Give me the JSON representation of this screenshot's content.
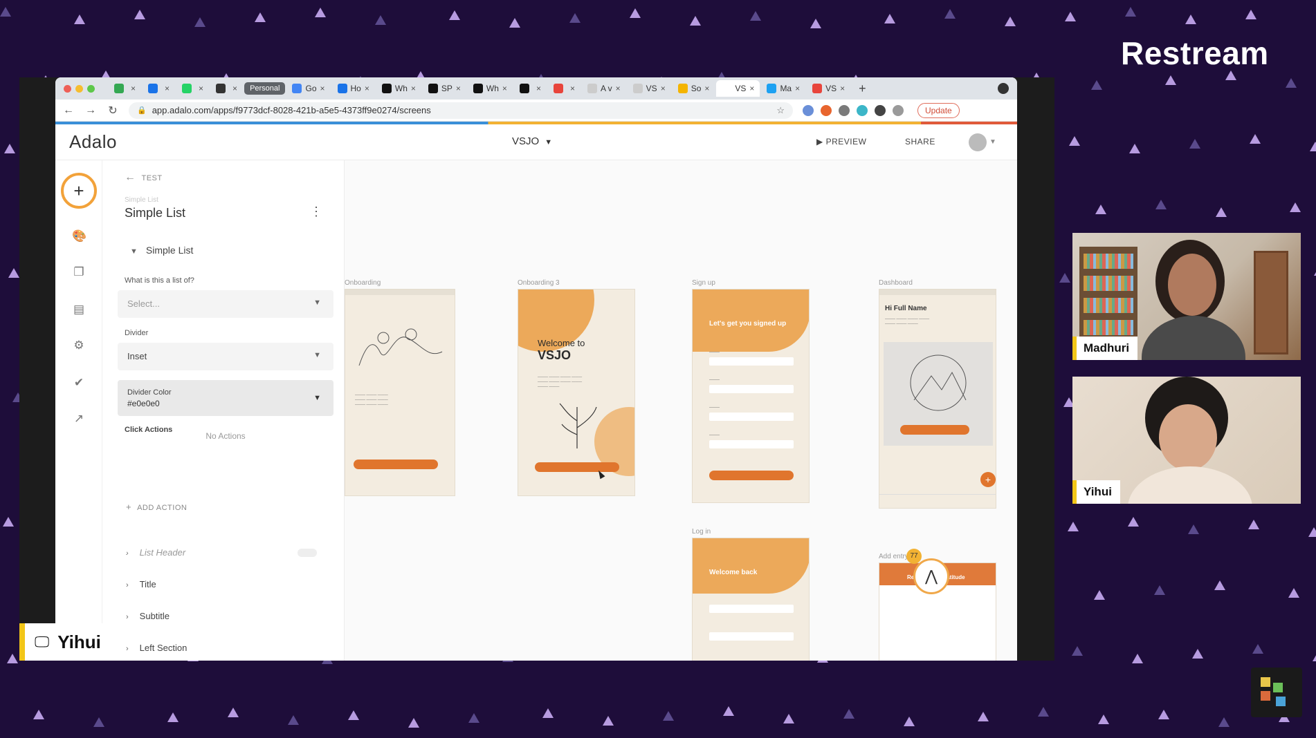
{
  "brand": "Restream",
  "browser": {
    "tabs": [
      {
        "label": "",
        "fav": "#34a853",
        "icon": "sheets-icon"
      },
      {
        "label": "",
        "fav": "#1a73e8",
        "icon": "telegram-icon"
      },
      {
        "label": "",
        "fav": "#25d366",
        "icon": "whatsapp-icon"
      },
      {
        "label": "",
        "fav": "#333333",
        "icon": "laptop-icon"
      },
      {
        "label": "Personal",
        "personal": true
      },
      {
        "label": "Go",
        "fav": "#4285f4",
        "icon": "docs-icon"
      },
      {
        "label": "Ho",
        "fav": "#1a73e8",
        "icon": "q-icon"
      },
      {
        "label": "Wh",
        "fav": "#111111",
        "icon": "cm-icon"
      },
      {
        "label": "SP",
        "fav": "#111111",
        "icon": "cm-icon"
      },
      {
        "label": "Wh",
        "fav": "#111111",
        "icon": "box-icon"
      },
      {
        "label": "",
        "fav": "#111111",
        "icon": "r-icon"
      },
      {
        "label": "",
        "fav": "#e8453c",
        "icon": "record-icon"
      },
      {
        "label": "A v",
        "fav": "#cccccc",
        "icon": "doc-icon"
      },
      {
        "label": "VS",
        "fav": "#cccccc",
        "icon": "doc-icon"
      },
      {
        "label": "So",
        "fav": "#f4b400",
        "icon": "slides-icon"
      },
      {
        "label": "VS",
        "fav": "#ffffff",
        "icon": "adalo-icon",
        "active": true
      },
      {
        "label": "Ma",
        "fav": "#1da1f2",
        "icon": "twitter-icon"
      },
      {
        "label": "VS",
        "fav": "#e8453c",
        "icon": "figma-icon"
      }
    ],
    "url": "app.adalo.com/apps/f9773dcf-8028-421b-a5e5-4373ff9e0274/screens",
    "update_label": "Update"
  },
  "appbar": {
    "logo": "Adalo",
    "app_name": "VSJO",
    "preview_label": "PREVIEW",
    "share_label": "SHARE"
  },
  "panel": {
    "back_label": "TEST",
    "component_subtitle": "Simple List",
    "component_title": "Simple List",
    "section_title": "Simple List",
    "list_of_label": "What is this a list of?",
    "list_of_placeholder": "Select...",
    "divider_label": "Divider",
    "divider_value": "Inset",
    "divider_color_label": "Divider Color",
    "divider_color_value": "#e0e0e0",
    "click_actions_label": "Click Actions",
    "no_actions": "No Actions",
    "add_action": "ADD ACTION",
    "rows": [
      "List Header",
      "Title",
      "Subtitle",
      "Left Section"
    ]
  },
  "canvas": {
    "screens": [
      {
        "label": "Onboarding"
      },
      {
        "label": "Onboarding 3",
        "title1": "Welcome to",
        "title2": "VSJO"
      },
      {
        "label": "Sign up",
        "title": "Let's get you signed up"
      },
      {
        "label": "Dashboard",
        "title": "Hi Full Name"
      },
      {
        "label": "Log in",
        "title": "Welcome back"
      },
      {
        "label": "Add entry",
        "title": "Record your gratitude"
      }
    ]
  },
  "fab_badge": "77",
  "presenter": {
    "name": "Yihui"
  },
  "cams": [
    {
      "name": "Madhuri"
    },
    {
      "name": "Yihui"
    }
  ]
}
